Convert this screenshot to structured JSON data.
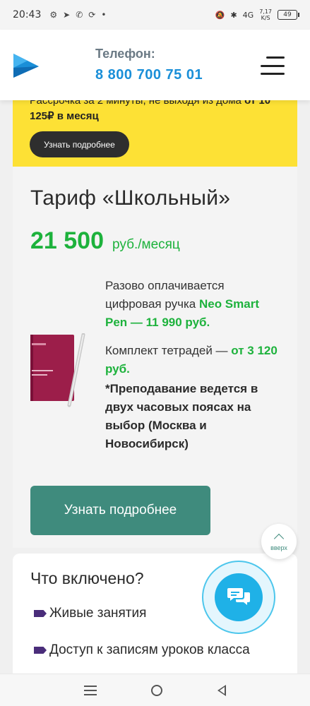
{
  "status_bar": {
    "time": "20:43",
    "network": "4G",
    "speed_value": "7,17",
    "speed_unit": "K/S",
    "battery": "49"
  },
  "header": {
    "phone_label": "Телефон:",
    "phone_number": "8 800 700 75 01"
  },
  "banner": {
    "text_normal": "Рассрочка за 2 минуты, не выходя из дома ",
    "text_bold_1": "от 10",
    "text_bold_2": "125₽ в месяц",
    "button_label": "Узнать подробнее"
  },
  "tariff": {
    "title": "Тариф «Школьный»",
    "price_value": "21 500",
    "price_unit": "руб./месяц",
    "pen_text": "Разово оплачивается цифровая ручка ",
    "pen_highlight": "Neo Smart Pen — 11 990 руб.",
    "notebooks_text": "Комплект тетрадей — ",
    "notebooks_highlight": "от 3 120 руб.",
    "note": "*Преподавание ведется в двух часовых поясах на выбор (Москва и Новосибирск)",
    "more_button": "Узнать подробнее"
  },
  "up_button": {
    "label": "вверх"
  },
  "included": {
    "title": "Что включено?",
    "items": [
      "Живые занятия",
      "Доступ к записям уроков класса"
    ]
  },
  "colors": {
    "accent_green": "#1db23c",
    "button_teal": "#3f8b7d",
    "banner_yellow": "#fde135",
    "phone_blue": "#1a8fd8",
    "chat_blue": "#1fb1e7"
  }
}
